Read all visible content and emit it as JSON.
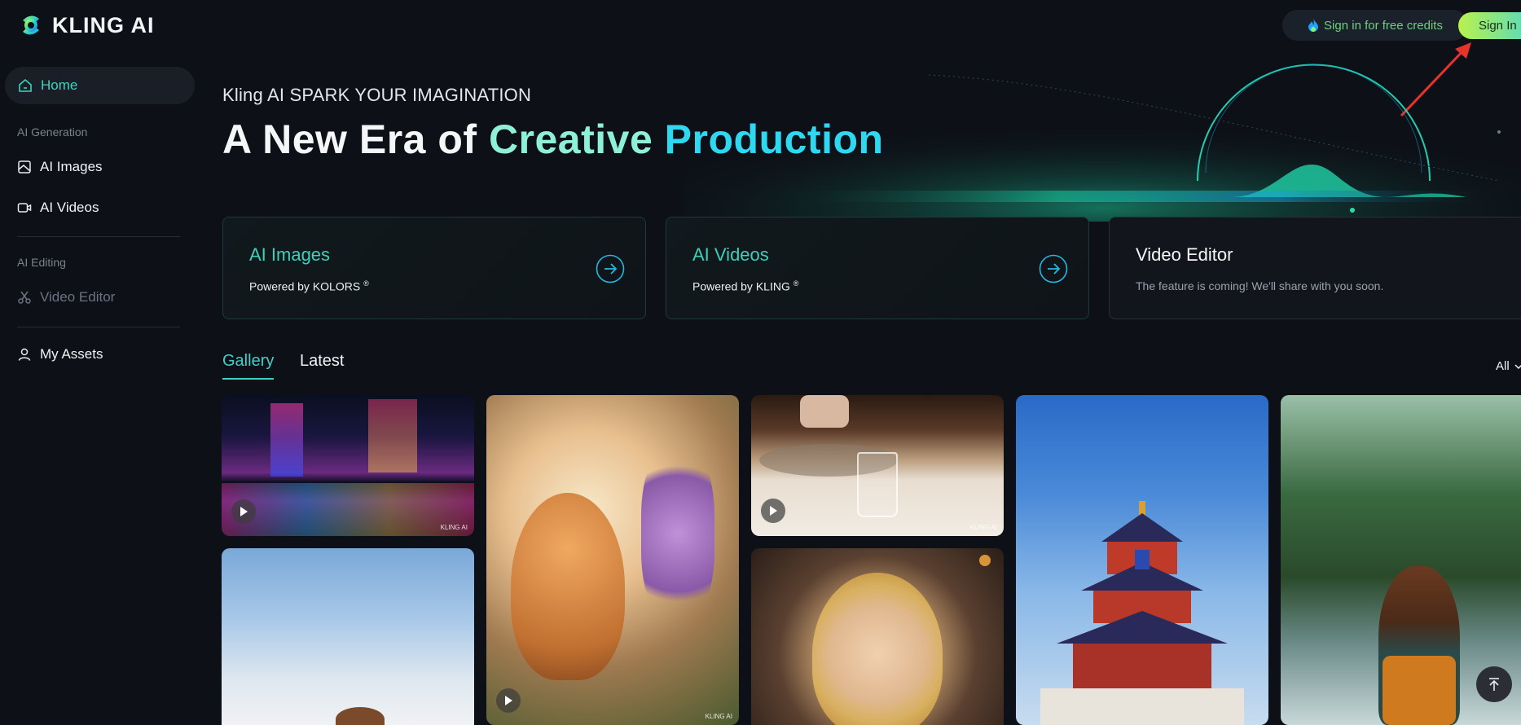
{
  "brand": {
    "name": "KLING AI"
  },
  "topbar": {
    "credits_label": "Sign in for free credits",
    "signin_label": "Sign In"
  },
  "sidebar": {
    "home": "Home",
    "section_generation": "AI Generation",
    "ai_images": "AI Images",
    "ai_videos": "AI Videos",
    "section_editing": "AI Editing",
    "video_editor": "Video Editor",
    "my_assets": "My Assets"
  },
  "hero": {
    "subtitle": "Kling AI SPARK YOUR IMAGINATION",
    "title_part1": "A New Era of ",
    "title_part2": "Creative ",
    "title_part3": "Production"
  },
  "cards": [
    {
      "title": "AI Images",
      "subtitle": "Powered by KOLORS",
      "mark": "®"
    },
    {
      "title": "AI Videos",
      "subtitle": "Powered by KLING",
      "mark": "®"
    },
    {
      "title": "Video Editor",
      "subtitle": "The feature is coming! We'll share with you soon."
    }
  ],
  "gallery": {
    "tabs": [
      "Gallery",
      "Latest"
    ],
    "filter": "All",
    "watermark": "KLING AI",
    "tiles": [
      {
        "name": "tile-city-night",
        "kind": "video"
      },
      {
        "name": "tile-cat-flowers",
        "kind": "video"
      },
      {
        "name": "tile-glass-sink",
        "kind": "video"
      },
      {
        "name": "tile-temple-of-heaven",
        "kind": "image"
      },
      {
        "name": "tile-jungle-river-hiker",
        "kind": "image"
      },
      {
        "name": "tile-sky-dog",
        "kind": "image"
      },
      {
        "name": "tile-blonde-portrait",
        "kind": "image"
      }
    ]
  },
  "colors": {
    "accent": "#3ed0c8",
    "cyan": "#2ed8f0",
    "mint": "#8ff0d8",
    "bg": "#0d1117"
  }
}
